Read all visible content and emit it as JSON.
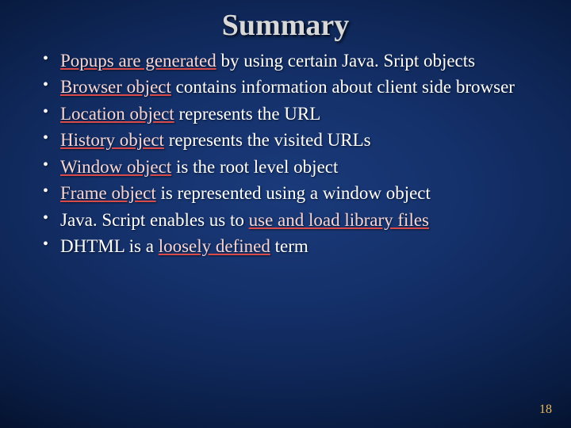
{
  "title": "Summary",
  "bullets": [
    {
      "pre": "",
      "u": "Popups are generated",
      "post": " by using certain Java. Sript objects"
    },
    {
      "pre": "",
      "u": "Browser object",
      "post": " contains information about client side browser"
    },
    {
      "pre": "",
      "u": "Location object",
      "post": " represents the URL"
    },
    {
      "pre": "",
      "u": "History object",
      "post": " represents the visited URLs"
    },
    {
      "pre": "",
      "u": "Window object",
      "post": " is the root level object"
    },
    {
      "pre": "",
      "u": "Frame object",
      "post": " is represented using a window object"
    },
    {
      "pre": "Java. Script enables us to ",
      "u": "use and load library files",
      "post": ""
    },
    {
      "pre": "DHTML is a ",
      "u": "loosely defined",
      "post": " term"
    }
  ],
  "page_number": "18"
}
